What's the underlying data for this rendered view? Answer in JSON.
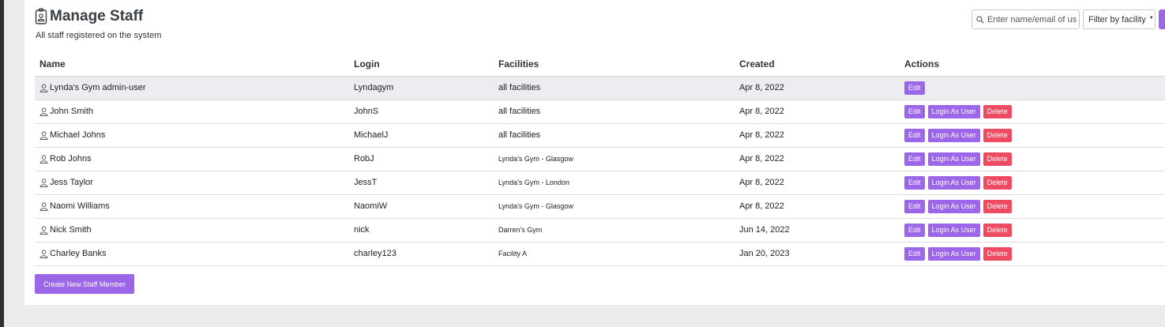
{
  "header": {
    "title": "Manage Staff",
    "subtitle": "All staff registered on the system",
    "title_icon": "badge-icon"
  },
  "toolbar": {
    "search_placeholder": "Enter name/email of us",
    "filter_label": "Filter by facility",
    "search_icon": "search-icon"
  },
  "table": {
    "columns": [
      "Name",
      "Login",
      "Facilities",
      "Created",
      "Actions"
    ],
    "rows": [
      {
        "name": "Lynda's Gym admin-user",
        "login": "Lyndagym",
        "facilities": "all facilities",
        "created": "Apr 8, 2022",
        "actions": [
          "Edit"
        ]
      },
      {
        "name": "John Smith",
        "login": "JohnS",
        "facilities": "all facilities",
        "created": "Apr 8, 2022",
        "actions": [
          "Edit",
          "Login As User",
          "Delete"
        ]
      },
      {
        "name": "Michael Johns",
        "login": "MichaelJ",
        "facilities": "all facilities",
        "created": "Apr 8, 2022",
        "actions": [
          "Edit",
          "Login As User",
          "Delete"
        ]
      },
      {
        "name": "Rob Johns",
        "login": "RobJ",
        "facilities": "Lynda's Gym - Glasgow",
        "created": "Apr 8, 2022",
        "actions": [
          "Edit",
          "Login As User",
          "Delete"
        ]
      },
      {
        "name": "Jess Taylor",
        "login": "JessT",
        "facilities": "Lynda's Gym - London",
        "created": "Apr 8, 2022",
        "actions": [
          "Edit",
          "Login As User",
          "Delete"
        ]
      },
      {
        "name": "Naomi Williams",
        "login": "NaomiW",
        "facilities": "Lynda's Gym - Glasgow",
        "created": "Apr 8, 2022",
        "actions": [
          "Edit",
          "Login As User",
          "Delete"
        ]
      },
      {
        "name": "Nick Smith",
        "login": "nick",
        "facilities": "Darren's Gym",
        "created": "Jun 14, 2022",
        "actions": [
          "Edit",
          "Login As User",
          "Delete"
        ]
      },
      {
        "name": "Charley Banks",
        "login": "charley123",
        "facilities": "Facility A",
        "created": "Jan 20, 2023",
        "actions": [
          "Edit",
          "Login As User",
          "Delete"
        ]
      }
    ]
  },
  "create_button_label": "Create New Staff Member",
  "colors": {
    "accent": "#9b66e8",
    "danger": "#ee4b62",
    "highlight_row": "#ebedf0"
  }
}
